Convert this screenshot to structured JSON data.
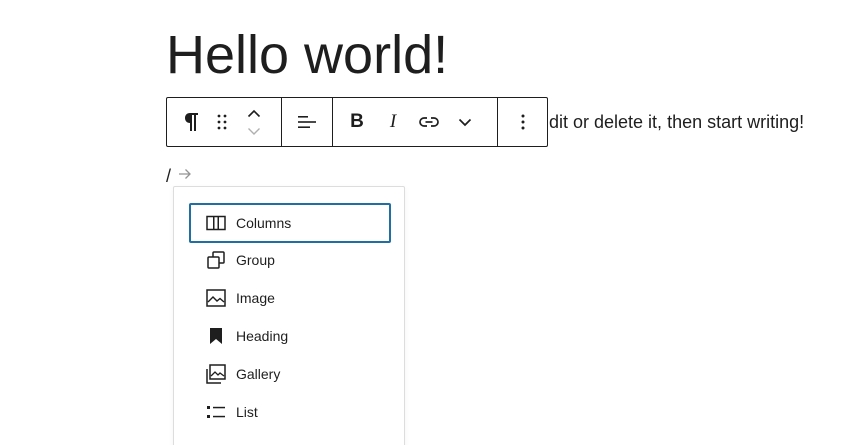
{
  "post": {
    "title": "Hello world!",
    "paragraph_visible_text": "dit or delete it, then start writing!"
  },
  "toolbar": {
    "block_type_icon": "paragraph-icon",
    "drag_icon": "drag-handle-icon",
    "move_up_icon": "chevron-up-icon",
    "move_down_icon": "chevron-down-icon",
    "align_icon": "align-left-icon",
    "bold_label": "B",
    "italic_label": "I",
    "link_icon": "link-icon",
    "more_formats_icon": "chevron-down-icon",
    "options_icon": "more-vertical-icon"
  },
  "slash_command": {
    "text": "/",
    "arrow_icon": "arrow-right-icon"
  },
  "inserter": {
    "items": [
      {
        "label": "Columns",
        "icon": "columns-icon",
        "selected": true
      },
      {
        "label": "Group",
        "icon": "group-icon",
        "selected": false
      },
      {
        "label": "Image",
        "icon": "image-icon",
        "selected": false
      },
      {
        "label": "Heading",
        "icon": "heading-bookmark-icon",
        "selected": false
      },
      {
        "label": "Gallery",
        "icon": "gallery-icon",
        "selected": false
      },
      {
        "label": "List",
        "icon": "list-icon",
        "selected": false
      }
    ]
  },
  "colors": {
    "text": "#1e1e1e",
    "border": "#1e1e1e",
    "popover_border": "#dddddd",
    "focus": "#1f6fa3",
    "muted": "#949494"
  }
}
